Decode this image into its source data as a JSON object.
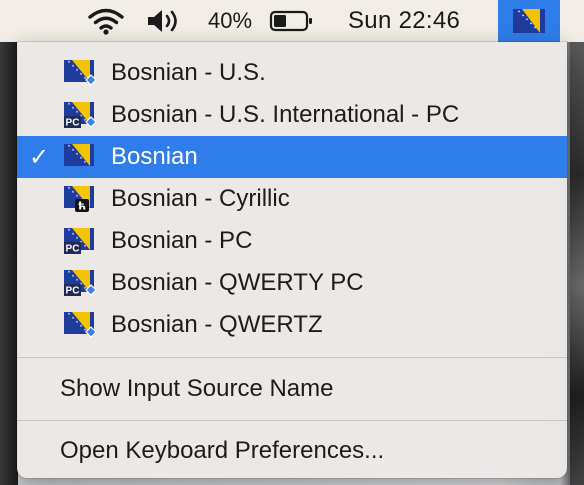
{
  "menubar": {
    "wifi_icon": "wifi-icon",
    "volume_icon": "speaker-volume-icon",
    "battery_percent": "40%",
    "battery_level": 0.4,
    "clock": "Sun 22:46",
    "input_source_icon": "bosnian-flag-icon"
  },
  "menu": {
    "sources": [
      {
        "label": "Bosnian - U.S.",
        "badge": "diamond",
        "checked": false
      },
      {
        "label": "Bosnian - U.S. International - PC",
        "badge": "pc-diamond",
        "checked": false
      },
      {
        "label": "Bosnian",
        "badge": "none",
        "checked": true
      },
      {
        "label": "Bosnian - Cyrillic",
        "badge": "cyrillic",
        "checked": false
      },
      {
        "label": "Bosnian - PC",
        "badge": "pc",
        "checked": false
      },
      {
        "label": "Bosnian - QWERTY PC",
        "badge": "pc-diamond",
        "checked": false
      },
      {
        "label": "Bosnian - QWERTZ",
        "badge": "diamond",
        "checked": false
      }
    ],
    "check_mark": "✓",
    "show_input_source_name": "Show Input Source Name",
    "open_keyboard_preferences": "Open Keyboard Preferences..."
  },
  "colors": {
    "selection": "#2f7dea",
    "flag_blue": "#1f3c9c",
    "flag_yellow": "#f5c400"
  }
}
